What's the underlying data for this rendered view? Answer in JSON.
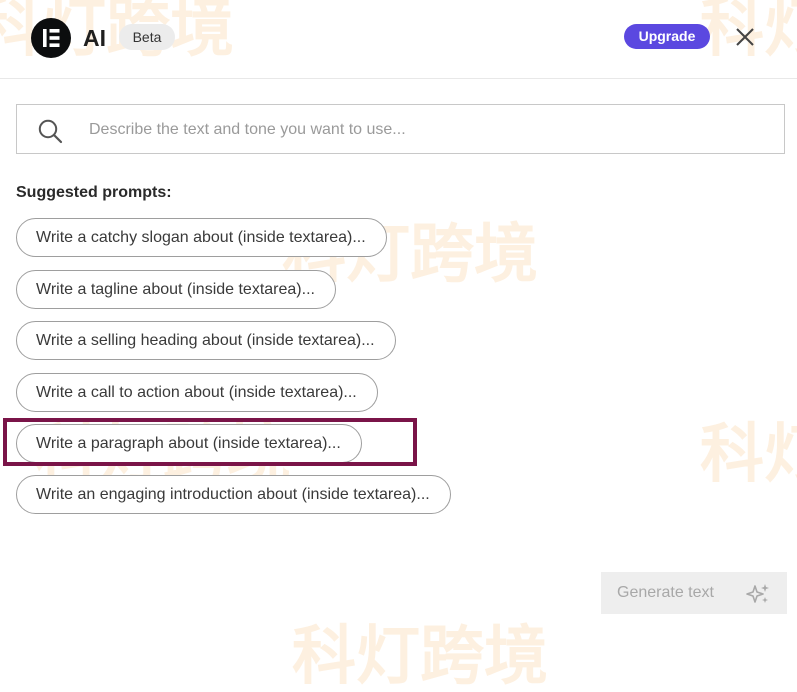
{
  "header": {
    "app_name": "AI",
    "beta_label": "Beta",
    "upgrade_label": "Upgrade"
  },
  "search": {
    "placeholder": "Describe the text and tone you want to use..."
  },
  "suggested": {
    "title": "Suggested prompts:",
    "items": [
      {
        "label": "Write a catchy slogan about (inside textarea)..."
      },
      {
        "label": "Write a tagline about (inside textarea)..."
      },
      {
        "label": "Write a selling heading about (inside textarea)..."
      },
      {
        "label": "Write a call to action about (inside textarea)..."
      },
      {
        "label": "Write a paragraph about (inside textarea)..."
      },
      {
        "label": "Write an engaging introduction about (inside textarea)..."
      }
    ]
  },
  "footer": {
    "generate_label": "Generate text"
  },
  "watermark": {
    "text": "科灯跨境"
  },
  "icons": {
    "logo": "elementor-logo-icon",
    "close": "close-icon",
    "search": "search-icon",
    "generate": "sparkle-icon"
  },
  "colors": {
    "accent": "#5b48e0",
    "highlight": "#7a1448",
    "logo_bg": "#0c0d0e"
  }
}
